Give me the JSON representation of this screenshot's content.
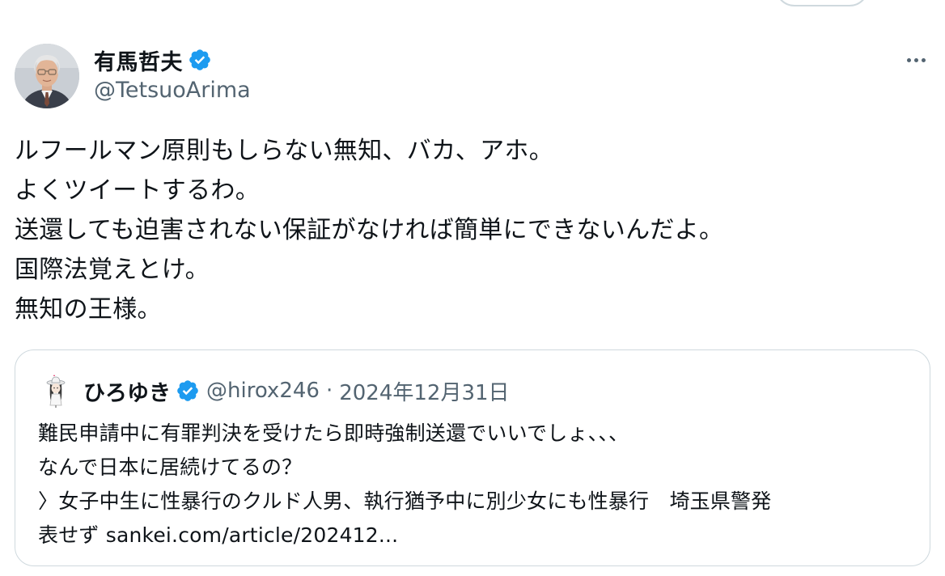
{
  "author": {
    "name": "有馬哲夫",
    "handle": "@TetsuoArima",
    "verified": true,
    "avatar": "author-avatar-photo"
  },
  "tweet": {
    "lines": [
      "ルフールマン原則もしらない無知、バカ、アホ。",
      "よくツイートするわ。",
      "送還しても迫害されない保証がなければ簡単にできないんだよ。",
      "国際法覚えとけ。",
      "無知の王様。"
    ]
  },
  "quote": {
    "name": "ひろゆき",
    "handle": "@hirox246",
    "separator": "·",
    "date": "2024年12月31日",
    "verified": true,
    "lines": [
      "難民申請中に有罪判決を受けたら即時強制送還でいいでしょ、、、",
      "なんで日本に居続けてるの？",
      "〉女子中生に性暴行のクルド人男、執行猶予中に別少女にも性暴行　埼玉県警発",
      "表せず sankei.com/article/202412..."
    ]
  },
  "icons": {
    "verified": "verified-badge-icon",
    "more": "more-options-icon"
  },
  "colors": {
    "verified": "#1d9bf0",
    "secondary_text": "#536471",
    "border": "#cfd9de",
    "text": "#0f1419"
  }
}
